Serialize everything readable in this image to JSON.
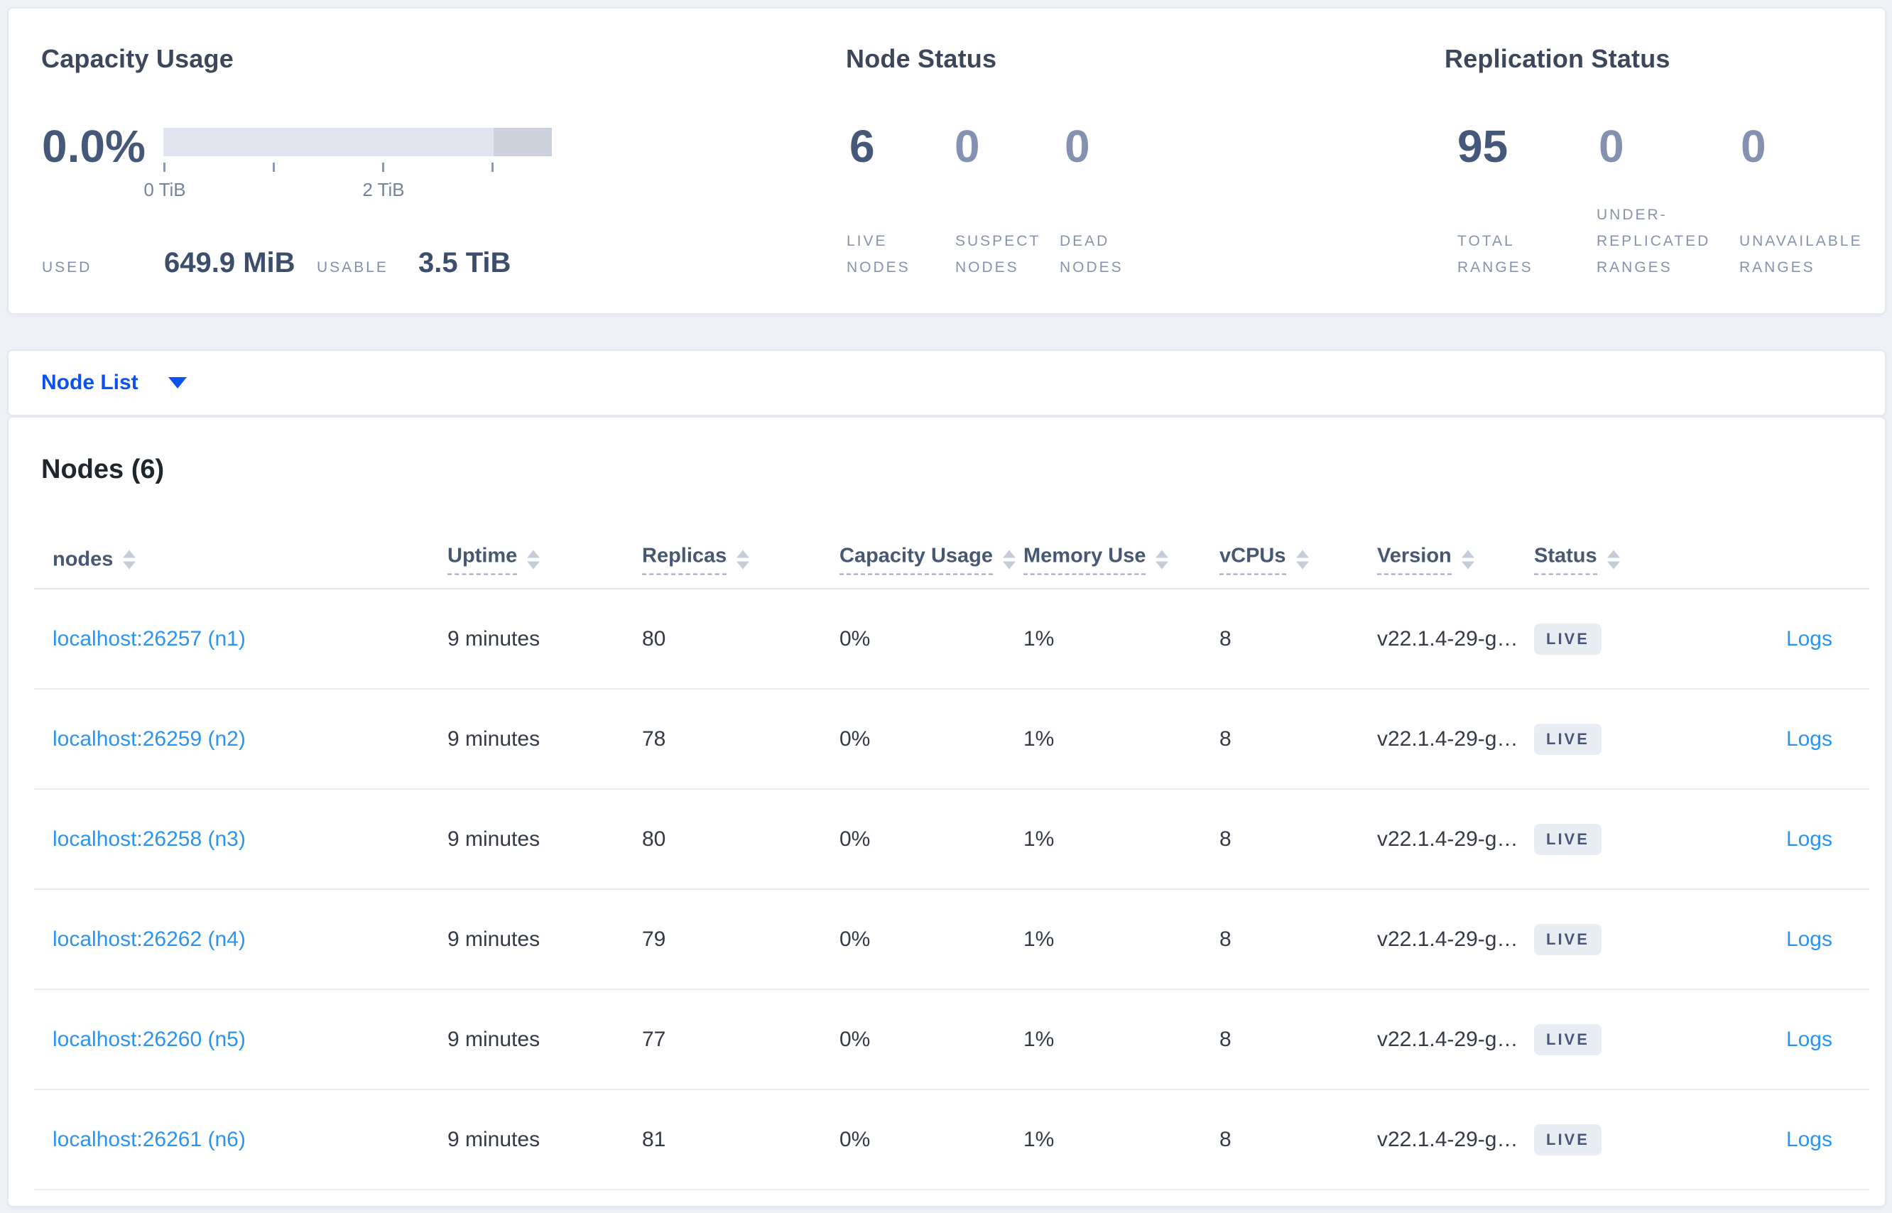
{
  "colors": {
    "accent_blue": "#0b52f0",
    "link_blue": "#2b94f2",
    "stat_dark": "#46587a",
    "stat_muted": "#8591b0",
    "live_badge_bg": "#e8edf4",
    "gauge_track": "#e2e5ef",
    "gauge_dark_segment": "#ced2dd"
  },
  "summary": {
    "capacity": {
      "title": "Capacity Usage",
      "percent": "0.0%",
      "tick_labels": [
        "0 TiB",
        "2 TiB"
      ],
      "used_label": "USED",
      "used_value": "649.9 MiB",
      "usable_label": "USABLE",
      "usable_value": "3.5 TiB"
    },
    "node_status": {
      "title": "Node Status",
      "stats": [
        {
          "value": "6",
          "lines": [
            "LIVE",
            "NODES"
          ]
        },
        {
          "value": "0",
          "lines": [
            "SUSPECT",
            "NODES"
          ]
        },
        {
          "value": "0",
          "lines": [
            "DEAD",
            "NODES"
          ]
        }
      ]
    },
    "replication": {
      "title": "Replication Status",
      "stats": [
        {
          "value": "95",
          "lines": [
            "TOTAL",
            "RANGES"
          ]
        },
        {
          "value": "0",
          "lines": [
            "UNDER-",
            "REPLICATED",
            "RANGES"
          ]
        },
        {
          "value": "0",
          "lines": [
            "UNAVAILABLE",
            "RANGES"
          ]
        }
      ]
    }
  },
  "node_list": {
    "label": "Node List"
  },
  "nodes_panel": {
    "title": "Nodes (6)",
    "columns": [
      {
        "label": "nodes"
      },
      {
        "label": "Uptime"
      },
      {
        "label": "Replicas"
      },
      {
        "label": "Capacity Usage"
      },
      {
        "label": "Memory Use"
      },
      {
        "label": "vCPUs"
      },
      {
        "label": "Version"
      },
      {
        "label": "Status"
      }
    ],
    "rows": [
      {
        "node": "localhost:26257 (n1)",
        "uptime": "9 minutes",
        "replicas": "80",
        "capacity": "0%",
        "memory": "1%",
        "vcpus": "8",
        "version": "v22.1.4-29-g…",
        "status": "LIVE",
        "logs": "Logs"
      },
      {
        "node": "localhost:26259 (n2)",
        "uptime": "9 minutes",
        "replicas": "78",
        "capacity": "0%",
        "memory": "1%",
        "vcpus": "8",
        "version": "v22.1.4-29-g…",
        "status": "LIVE",
        "logs": "Logs"
      },
      {
        "node": "localhost:26258 (n3)",
        "uptime": "9 minutes",
        "replicas": "80",
        "capacity": "0%",
        "memory": "1%",
        "vcpus": "8",
        "version": "v22.1.4-29-g…",
        "status": "LIVE",
        "logs": "Logs"
      },
      {
        "node": "localhost:26262 (n4)",
        "uptime": "9 minutes",
        "replicas": "79",
        "capacity": "0%",
        "memory": "1%",
        "vcpus": "8",
        "version": "v22.1.4-29-g…",
        "status": "LIVE",
        "logs": "Logs"
      },
      {
        "node": "localhost:26260 (n5)",
        "uptime": "9 minutes",
        "replicas": "77",
        "capacity": "0%",
        "memory": "1%",
        "vcpus": "8",
        "version": "v22.1.4-29-g…",
        "status": "LIVE",
        "logs": "Logs"
      },
      {
        "node": "localhost:26261 (n6)",
        "uptime": "9 minutes",
        "replicas": "81",
        "capacity": "0%",
        "memory": "1%",
        "vcpus": "8",
        "version": "v22.1.4-29-g…",
        "status": "LIVE",
        "logs": "Logs"
      }
    ]
  }
}
